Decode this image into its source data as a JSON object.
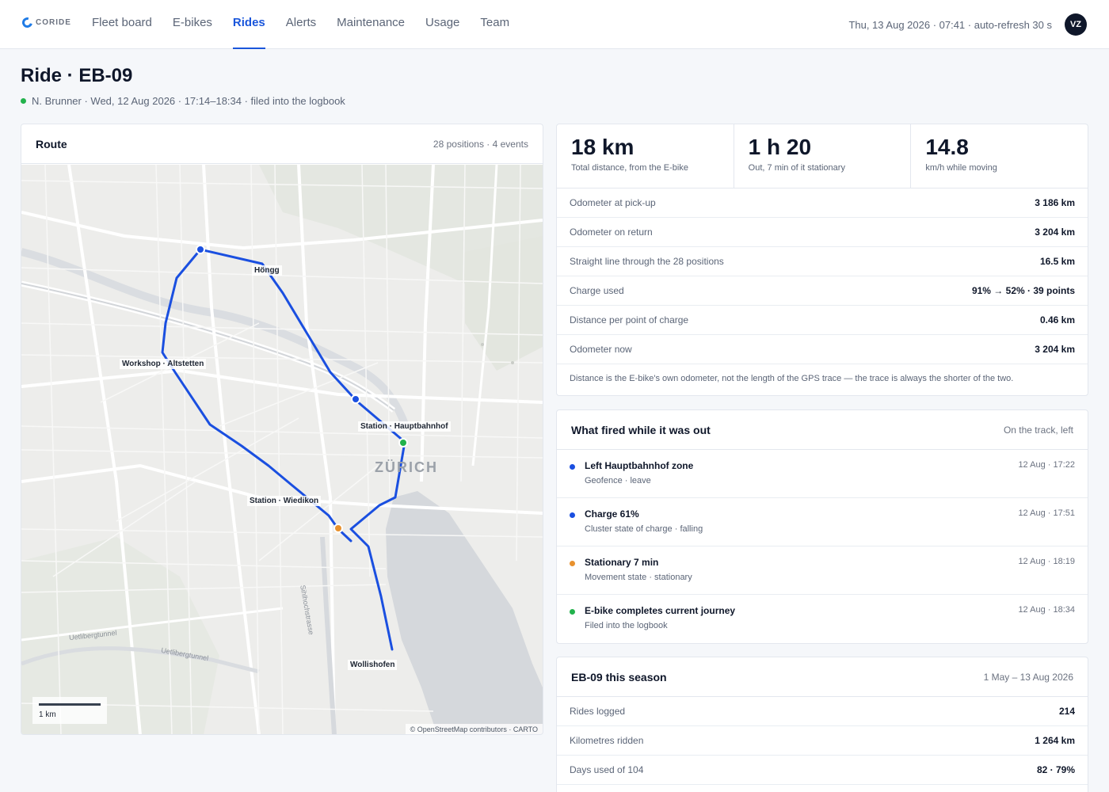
{
  "brand": {
    "name": "CORIDE"
  },
  "nav": [
    {
      "label": "Fleet board"
    },
    {
      "label": "E-bikes"
    },
    {
      "label": "Rides",
      "active": true
    },
    {
      "label": "Alerts"
    },
    {
      "label": "Maintenance"
    },
    {
      "label": "Usage"
    },
    {
      "label": "Team"
    }
  ],
  "header": {
    "datetime": "Thu, 13 Aug 2026 · 07:41 · auto-refresh 30 s",
    "avatar": "VZ"
  },
  "page": {
    "title": "Ride · EB-09",
    "subline": "N. Brunner · Wed, 12 Aug 2026 · 17:14–18:34 · filed into the logbook"
  },
  "route": {
    "title": "Route",
    "meta": "28 positions · 4 events",
    "places": {
      "hongg": "Höngg",
      "workshop": "Workshop · Altstetten",
      "hb": "Station · Hauptbahnhof",
      "wiedikon": "Station · Wiedikon",
      "wollishofen": "Wollishofen",
      "city": "ZÜRICH",
      "sihl": "Sihlhochstrasse",
      "uetli1": "Uetlibergtunnel",
      "uetli2": "Uetlibergtunnel"
    },
    "scale": "1 km",
    "attribution": "© OpenStreetMap contributors · CARTO"
  },
  "stats": {
    "kpis": [
      {
        "value": "18 km",
        "label": "Total distance, from the E-bike"
      },
      {
        "value": "1 h 20",
        "label": "Out, 7 min of it stationary"
      },
      {
        "value": "14.8",
        "label": "km/h while moving"
      }
    ],
    "rows": [
      {
        "label": "Odometer at pick-up",
        "value": "3 186 km"
      },
      {
        "label": "Odometer on return",
        "value": "3 204 km"
      },
      {
        "label": "Straight line through the 28 positions",
        "value": "16.5 km"
      },
      {
        "label": "Charge used",
        "value": "91% → 52% · 39 points"
      },
      {
        "label": "Distance per point of charge",
        "value": "0.46 km"
      },
      {
        "label": "Odometer now",
        "value": "3 204 km"
      }
    ],
    "note": "Distance is the E-bike's own odometer, not the length of the GPS trace — the trace is always the shorter of the two."
  },
  "events": {
    "title": "What fired while it was out",
    "meta": "On the track, left",
    "items": [
      {
        "title": "Left Hauptbahnhof zone",
        "sub": "Geofence · leave",
        "time": "12 Aug · 17:22",
        "color": "#1a4fe0"
      },
      {
        "title": "Charge 61%",
        "sub": "Cluster state of charge · falling",
        "time": "12 Aug · 17:51",
        "color": "#1a4fe0"
      },
      {
        "title": "Stationary 7 min",
        "sub": "Movement state · stationary",
        "time": "12 Aug · 18:19",
        "color": "#e8912e"
      },
      {
        "title": "E-bike completes current journey",
        "sub": "Filed into the logbook",
        "time": "12 Aug · 18:34",
        "color": "#22b24c"
      }
    ]
  },
  "season": {
    "title": "EB-09 this season",
    "meta": "1 May – 13 Aug 2026",
    "rows": [
      {
        "label": "Rides logged",
        "value": "214"
      },
      {
        "label": "Kilometres ridden",
        "value": "1 264 km"
      },
      {
        "label": "Days used of 104",
        "value": "82 · 79%"
      }
    ]
  },
  "colors": {
    "route": "#1a4fe0",
    "accent": "#1a56db",
    "stationary": "#e8912e",
    "complete": "#22b24c"
  }
}
